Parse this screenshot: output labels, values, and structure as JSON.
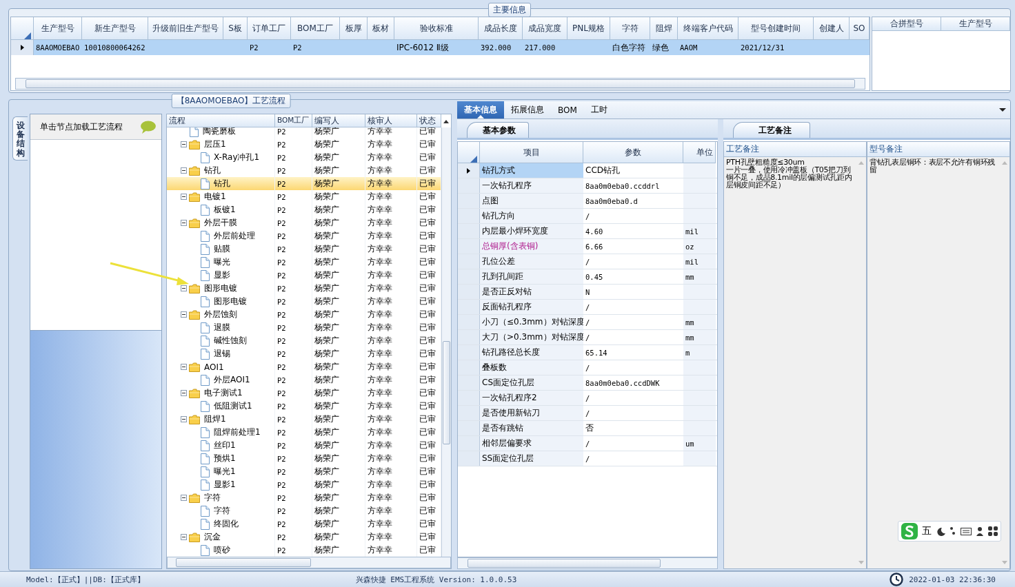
{
  "main_info": {
    "title": "主要信息",
    "columns": [
      "生产型号",
      "新生产型号",
      "升级前旧生产型号",
      "S板",
      "订单工厂",
      "BOM工厂",
      "板厚",
      "板材",
      "验收标准",
      "成品长度",
      "成品宽度",
      "PNL规格",
      "字符",
      "阻焊",
      "终端客户代码",
      "型号创建时间",
      "创建人",
      "SO"
    ],
    "rows": [
      {
        "selected": true,
        "cells": [
          "8AAOMOEBAO",
          "10010800064262",
          "",
          "",
          "P2",
          "P2",
          "",
          "",
          "IPC-6012 Ⅱ级",
          "392.000",
          "217.000",
          "",
          "白色字符",
          "绿色",
          "AAOM",
          "2021/12/31",
          "",
          ""
        ]
      }
    ],
    "side_columns": [
      "合拼型号",
      "生产型号"
    ]
  },
  "flow": {
    "title": "【8AAOMOEBAO】工艺流程",
    "side_tab": "设备结构",
    "hint": "单击节点加载工艺流程",
    "columns": [
      "流程",
      "BOM工厂",
      "编写人",
      "核审人",
      "状态"
    ],
    "nodes": [
      {
        "kind": "file",
        "label": "陶瓷磨板",
        "bom": "P2",
        "writer": "杨荣广",
        "reviewer": "方幸幸",
        "status": "已审",
        "selected": false
      },
      {
        "kind": "folder",
        "label": "层压1",
        "bom": "P2",
        "writer": "杨荣广",
        "reviewer": "方幸幸",
        "status": "已审",
        "selected": false,
        "expanded": true,
        "children": [
          {
            "kind": "file",
            "label": "X-Ray冲孔1",
            "bom": "P2",
            "writer": "杨荣广",
            "reviewer": "方幸幸",
            "status": "已审",
            "selected": false
          }
        ]
      },
      {
        "kind": "folder",
        "label": "钻孔",
        "bom": "P2",
        "writer": "杨荣广",
        "reviewer": "方幸幸",
        "status": "已审",
        "selected": false,
        "expanded": true,
        "children": [
          {
            "kind": "file",
            "label": "钻孔",
            "bom": "P2",
            "writer": "杨荣广",
            "reviewer": "方幸幸",
            "status": "已审",
            "selected": true
          }
        ]
      },
      {
        "kind": "folder",
        "label": "电镀1",
        "bom": "P2",
        "writer": "杨荣广",
        "reviewer": "方幸幸",
        "status": "已审",
        "selected": false,
        "expanded": true,
        "children": [
          {
            "kind": "file",
            "label": "板镀1",
            "bom": "P2",
            "writer": "杨荣广",
            "reviewer": "方幸幸",
            "status": "已审",
            "selected": false
          }
        ]
      },
      {
        "kind": "folder",
        "label": "外层干膜",
        "bom": "P2",
        "writer": "杨荣广",
        "reviewer": "方幸幸",
        "status": "已审",
        "selected": false,
        "expanded": true,
        "children": [
          {
            "kind": "file",
            "label": "外层前处理",
            "bom": "P2",
            "writer": "杨荣广",
            "reviewer": "方幸幸",
            "status": "已审",
            "selected": false
          },
          {
            "kind": "file",
            "label": "贴膜",
            "bom": "P2",
            "writer": "杨荣广",
            "reviewer": "方幸幸",
            "status": "已审",
            "selected": false
          },
          {
            "kind": "file",
            "label": "曝光",
            "bom": "P2",
            "writer": "杨荣广",
            "reviewer": "方幸幸",
            "status": "已审",
            "selected": false
          },
          {
            "kind": "file",
            "label": "显影",
            "bom": "P2",
            "writer": "杨荣广",
            "reviewer": "方幸幸",
            "status": "已审",
            "selected": false
          }
        ]
      },
      {
        "kind": "folder",
        "label": "图形电镀",
        "bom": "P2",
        "writer": "杨荣广",
        "reviewer": "方幸幸",
        "status": "已审",
        "selected": false,
        "expanded": true,
        "children": [
          {
            "kind": "file",
            "label": "图形电镀",
            "bom": "P2",
            "writer": "杨荣广",
            "reviewer": "方幸幸",
            "status": "已审",
            "selected": false
          }
        ]
      },
      {
        "kind": "folder",
        "label": "外层蚀刻",
        "bom": "P2",
        "writer": "杨荣广",
        "reviewer": "方幸幸",
        "status": "已审",
        "selected": false,
        "expanded": true,
        "children": [
          {
            "kind": "file",
            "label": "退膜",
            "bom": "P2",
            "writer": "杨荣广",
            "reviewer": "方幸幸",
            "status": "已审",
            "selected": false
          },
          {
            "kind": "file",
            "label": "碱性蚀刻",
            "bom": "P2",
            "writer": "杨荣广",
            "reviewer": "方幸幸",
            "status": "已审",
            "selected": false
          },
          {
            "kind": "file",
            "label": "退锡",
            "bom": "P2",
            "writer": "杨荣广",
            "reviewer": "方幸幸",
            "status": "已审",
            "selected": false
          }
        ]
      },
      {
        "kind": "folder",
        "label": "AOI1",
        "bom": "P2",
        "writer": "杨荣广",
        "reviewer": "方幸幸",
        "status": "已审",
        "selected": false,
        "expanded": true,
        "children": [
          {
            "kind": "file",
            "label": "外层AOI1",
            "bom": "P2",
            "writer": "杨荣广",
            "reviewer": "方幸幸",
            "status": "已审",
            "selected": false
          }
        ]
      },
      {
        "kind": "folder",
        "label": "电子测试1",
        "bom": "P2",
        "writer": "杨荣广",
        "reviewer": "方幸幸",
        "status": "已审",
        "selected": false,
        "expanded": true,
        "children": [
          {
            "kind": "file",
            "label": "低阻测试1",
            "bom": "P2",
            "writer": "杨荣广",
            "reviewer": "方幸幸",
            "status": "已审",
            "selected": false
          }
        ]
      },
      {
        "kind": "folder",
        "label": "阻焊1",
        "bom": "P2",
        "writer": "杨荣广",
        "reviewer": "方幸幸",
        "status": "已审",
        "selected": false,
        "expanded": true,
        "children": [
          {
            "kind": "file",
            "label": "阻焊前处理1",
            "bom": "P2",
            "writer": "杨荣广",
            "reviewer": "方幸幸",
            "status": "已审",
            "selected": false
          },
          {
            "kind": "file",
            "label": "丝印1",
            "bom": "P2",
            "writer": "杨荣广",
            "reviewer": "方幸幸",
            "status": "已审",
            "selected": false
          },
          {
            "kind": "file",
            "label": "预烘1",
            "bom": "P2",
            "writer": "杨荣广",
            "reviewer": "方幸幸",
            "status": "已审",
            "selected": false
          },
          {
            "kind": "file",
            "label": "曝光1",
            "bom": "P2",
            "writer": "杨荣广",
            "reviewer": "方幸幸",
            "status": "已审",
            "selected": false
          },
          {
            "kind": "file",
            "label": "显影1",
            "bom": "P2",
            "writer": "杨荣广",
            "reviewer": "方幸幸",
            "status": "已审",
            "selected": false
          }
        ]
      },
      {
        "kind": "folder",
        "label": "字符",
        "bom": "P2",
        "writer": "杨荣广",
        "reviewer": "方幸幸",
        "status": "已审",
        "selected": false,
        "expanded": true,
        "children": [
          {
            "kind": "file",
            "label": "字符",
            "bom": "P2",
            "writer": "杨荣广",
            "reviewer": "方幸幸",
            "status": "已审",
            "selected": false
          },
          {
            "kind": "file",
            "label": "终固化",
            "bom": "P2",
            "writer": "杨荣广",
            "reviewer": "方幸幸",
            "status": "已审",
            "selected": false
          }
        ]
      },
      {
        "kind": "folder",
        "label": "沉金",
        "bom": "P2",
        "writer": "杨荣广",
        "reviewer": "方幸幸",
        "status": "已审",
        "selected": false,
        "expanded": true,
        "children": [
          {
            "kind": "file",
            "label": "喷砂",
            "bom": "P2",
            "writer": "杨荣广",
            "reviewer": "方幸幸",
            "status": "已审",
            "selected": false
          }
        ]
      }
    ]
  },
  "detail_tabs": [
    {
      "label": "基本信息",
      "selected": true
    },
    {
      "label": "拓展信息",
      "selected": false
    },
    {
      "label": "BOM",
      "selected": false
    },
    {
      "label": "工时",
      "selected": false
    }
  ],
  "params": {
    "tab": "基本参数",
    "columns": [
      "项目",
      "参数",
      "单位"
    ],
    "rows": [
      {
        "item": "钻孔方式",
        "value": "CCD钻孔",
        "unit": "",
        "selected": true,
        "flagged": false
      },
      {
        "item": "一次钻孔程序",
        "value": "8aa0m0eba0.ccddrl",
        "unit": "",
        "selected": false,
        "flagged": false
      },
      {
        "item": "点图",
        "value": "8aa0m0eba0.d",
        "unit": "",
        "selected": false,
        "flagged": false
      },
      {
        "item": "钻孔方向",
        "value": "/",
        "unit": "",
        "selected": false,
        "flagged": false
      },
      {
        "item": "内层最小焊环宽度",
        "value": "4.60",
        "unit": "mil",
        "selected": false,
        "flagged": false
      },
      {
        "item": "总铜厚(含表铜)",
        "value": "6.66",
        "unit": "oz",
        "selected": false,
        "flagged": true
      },
      {
        "item": "孔位公差",
        "value": "/",
        "unit": "mil",
        "selected": false,
        "flagged": false
      },
      {
        "item": "孔到孔间距",
        "value": "0.45",
        "unit": "mm",
        "selected": false,
        "flagged": false
      },
      {
        "item": "是否正反对钻",
        "value": "N",
        "unit": "",
        "selected": false,
        "flagged": false
      },
      {
        "item": "反面钻孔程序",
        "value": "/",
        "unit": "",
        "selected": false,
        "flagged": false
      },
      {
        "item": "小刀（≤0.3mm）对钻深度",
        "value": "/",
        "unit": "mm",
        "selected": false,
        "flagged": false
      },
      {
        "item": "大刀（>0.3mm）对钻深度",
        "value": "/",
        "unit": "mm",
        "selected": false,
        "flagged": false
      },
      {
        "item": "钻孔路径总长度",
        "value": "65.14",
        "unit": "m",
        "selected": false,
        "flagged": false
      },
      {
        "item": "叠板数",
        "value": "/",
        "unit": "",
        "selected": false,
        "flagged": false
      },
      {
        "item": "CS面定位孔层",
        "value": "8aa0m0eba0.ccdDWK",
        "unit": "",
        "selected": false,
        "flagged": false
      },
      {
        "item": "一次钻孔程序2",
        "value": "/",
        "unit": "",
        "selected": false,
        "flagged": false
      },
      {
        "item": "是否使用新钻刀",
        "value": "/",
        "unit": "",
        "selected": false,
        "flagged": false
      },
      {
        "item": "是否有跳钻",
        "value": "否",
        "unit": "",
        "selected": false,
        "flagged": false
      },
      {
        "item": "相邻层偏要求",
        "value": "/",
        "unit": "um",
        "selected": false,
        "flagged": false
      },
      {
        "item": "SS面定位孔层",
        "value": "/",
        "unit": "",
        "selected": false,
        "flagged": false
      }
    ]
  },
  "notes": {
    "tab": "工艺备注",
    "columns": [
      "工艺备注",
      "型号备注"
    ],
    "texts": [
      "PTH孔壁粗糙度≤30um\n一片一叠，使用冷冲盖板（T05把刀到铜不足，成品8.1mil的层偏测试孔距内层铜皮间距不足）",
      "背钻孔表层铜环：表层不允许有铜环残留"
    ]
  },
  "ime_bar": {
    "mode": "五"
  },
  "status_bar": {
    "model": "Model:【正式】||DB:【正式库】",
    "app": "兴森快捷 EMS工程系统 Version: 1.0.0.53",
    "datetime": "2022-01-03 22:36:30"
  }
}
